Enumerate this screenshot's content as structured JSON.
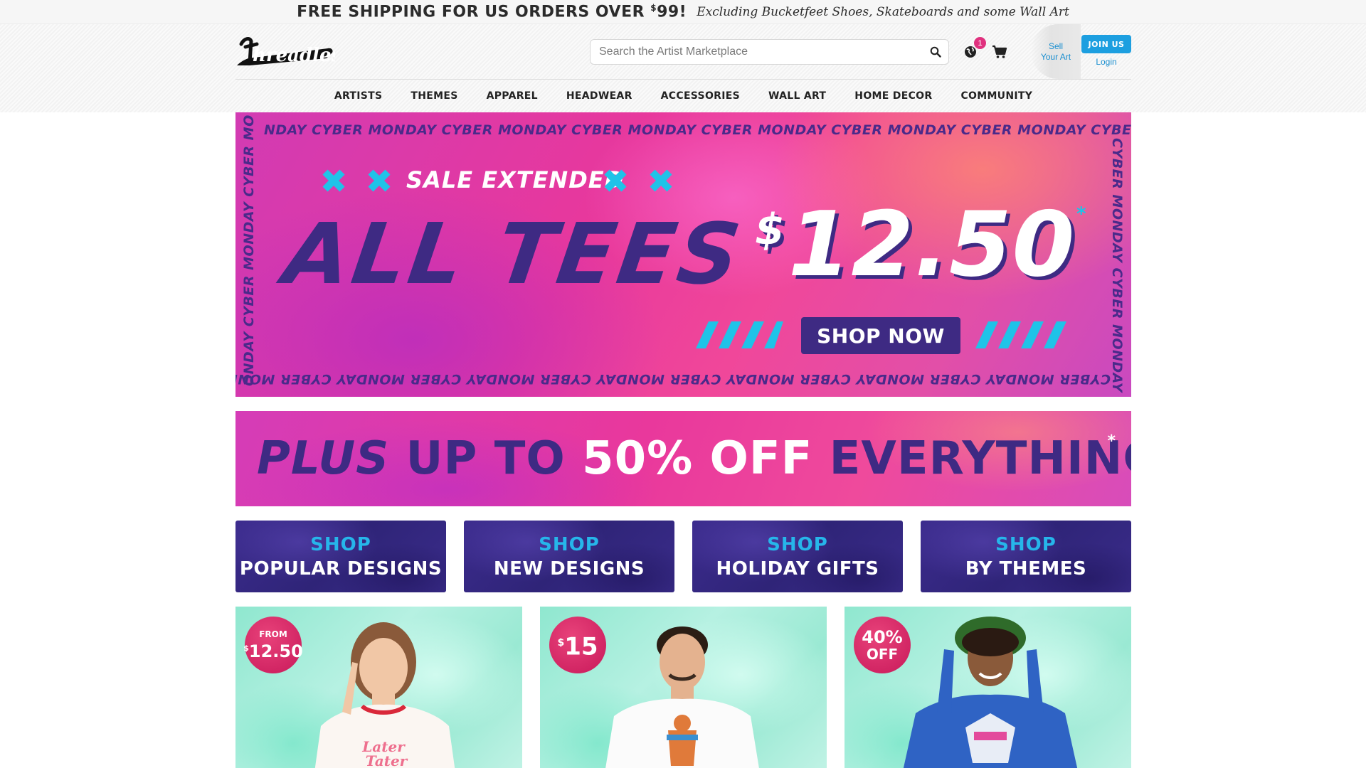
{
  "promo": {
    "main_prefix": "FREE SHIPPING FOR US ORDERS OVER ",
    "main_currency": "$",
    "main_amount": "99!",
    "sub": "Excluding Bucketfeet Shoes, Skateboards and some Wall Art"
  },
  "header": {
    "logo_alt": "threadless",
    "search_placeholder": "Search the Artist Marketplace",
    "search_icon": "search-icon",
    "globe_icon": "globe-icon",
    "notification_count": "1",
    "cart_icon": "cart-icon",
    "sell_line1": "Sell",
    "sell_line2": "Your Art",
    "join_label": "JOIN US",
    "login_label": "Login"
  },
  "nav": {
    "items": [
      "ARTISTS",
      "THEMES",
      "APPAREL",
      "HEADWEAR",
      "ACCESSORIES",
      "WALL ART",
      "HOME DECOR",
      "COMMUNITY"
    ]
  },
  "hero": {
    "cyber_top": "NDAY  CYBER MONDAY CYBER MONDAY CYBER MONDAY CYBER MONDAY CYBER MONDAY CYBER MONDAY  CYBER MONDAY",
    "cyber_bottom": "CYBER MONDAY CYBER MONDAY CYBER MONDAY  CYBER MONDAY CYBER MONDAY  CYBER MONDAY CYBER MONDAY CYBER M",
    "cyber_left": "ONDAY  CYBER MONDAY CYBER MO",
    "cyber_right": "CYBER MONDAY CYBER MONDAY C",
    "sale_extended": "SALE EXTENDED",
    "headline": "ALL TEES",
    "price_symbol": "$",
    "price": "12.50",
    "asterisk": "*",
    "cta": "SHOP NOW",
    "colors": {
      "navy": "#3e2a83",
      "cyan": "#1fc3e8",
      "pink": "#e8389c"
    }
  },
  "sub_banner": {
    "part1": "PLUS",
    "part2": " UP TO ",
    "part3": "50% OFF",
    "part4": " EVERYTHING!",
    "asterisk": "*"
  },
  "tiles": [
    {
      "shop": "SHOP",
      "label": "POPULAR DESIGNS"
    },
    {
      "shop": "SHOP",
      "label": "NEW DESIGNS"
    },
    {
      "shop": "SHOP",
      "label": "HOLIDAY GIFTS"
    },
    {
      "shop": "SHOP",
      "label": "BY THEMES"
    }
  ],
  "cards": [
    {
      "badge_top": "FROM",
      "badge_currency": "$",
      "badge_value": "12.50"
    },
    {
      "badge_currency": "$",
      "badge_value": "15"
    },
    {
      "badge_value": "40%",
      "badge_bottom": "OFF"
    }
  ]
}
